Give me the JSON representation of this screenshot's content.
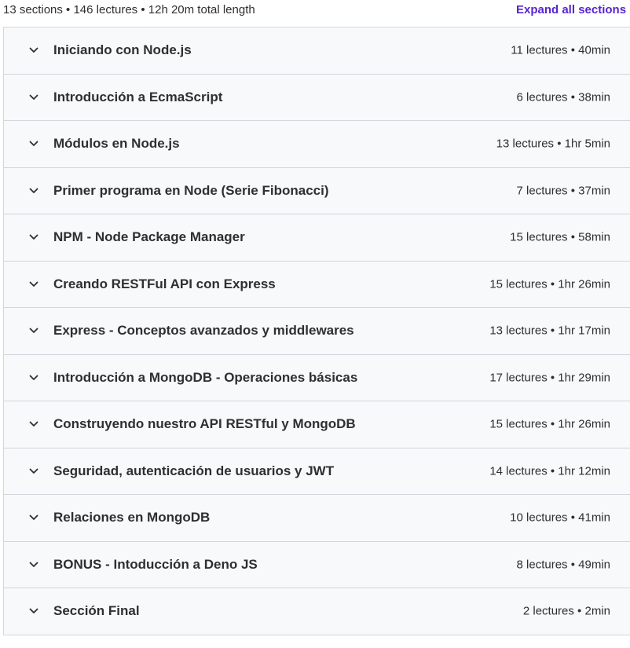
{
  "header": {
    "summary": "13 sections • 146 lectures • 12h 20m total length",
    "expand_label": "Expand all sections"
  },
  "sections": [
    {
      "title": "Iniciando con Node.js",
      "meta": "11 lectures • 40min"
    },
    {
      "title": "Introducción a EcmaScript",
      "meta": "6 lectures • 38min"
    },
    {
      "title": "Módulos en Node.js",
      "meta": "13 lectures • 1hr 5min"
    },
    {
      "title": "Primer programa en Node (Serie Fibonacci)",
      "meta": "7 lectures • 37min"
    },
    {
      "title": "NPM - Node Package Manager",
      "meta": "15 lectures • 58min"
    },
    {
      "title": "Creando RESTFul API con Express",
      "meta": "15 lectures • 1hr 26min"
    },
    {
      "title": "Express - Conceptos avanzados y middlewares",
      "meta": "13 lectures • 1hr 17min"
    },
    {
      "title": "Introducción a MongoDB - Operaciones básicas",
      "meta": "17 lectures • 1hr 29min"
    },
    {
      "title": "Construyendo nuestro API RESTful y MongoDB",
      "meta": "15 lectures • 1hr 26min"
    },
    {
      "title": "Seguridad, autenticación de usuarios y JWT",
      "meta": "14 lectures • 1hr 12min"
    },
    {
      "title": "Relaciones en MongoDB",
      "meta": "10 lectures • 41min"
    },
    {
      "title": "BONUS - Intoducción a Deno JS",
      "meta": "8 lectures • 49min"
    },
    {
      "title": "Sección Final",
      "meta": "2 lectures • 2min"
    }
  ],
  "icons": {
    "section_toggle": "chevron-down-icon"
  },
  "colors": {
    "accent": "#5624d0",
    "text": "#2d2f31",
    "row_background": "#f7f9fa",
    "border": "#d1d7dc"
  }
}
